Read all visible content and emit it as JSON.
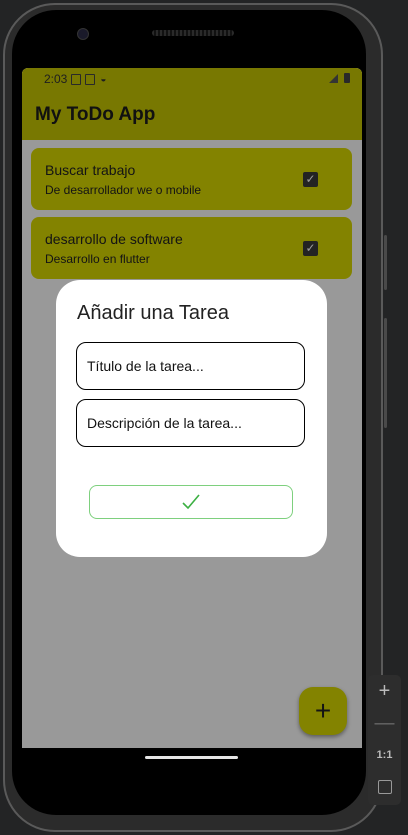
{
  "status_bar": {
    "time": "2:03"
  },
  "app_bar": {
    "title": "My ToDo App"
  },
  "tasks": [
    {
      "title": "Buscar trabajo",
      "description": "De desarrollador we o mobile",
      "checked": true
    },
    {
      "title": "desarrollo de software",
      "description": "Desarrollo en flutter",
      "checked": true
    }
  ],
  "dialog": {
    "title": "Añadir una Tarea",
    "title_placeholder": "Título de la tarea...",
    "description_placeholder": "Descripción de la tarea...",
    "confirm_icon": "check-icon"
  },
  "fab": {
    "icon": "plus-icon",
    "label": "+"
  },
  "emulator_controls": {
    "zoom_in": "+",
    "zoom_out": "—",
    "actual_size": "1:1"
  },
  "colors": {
    "accent": "#d6d600",
    "appbar": "#c4c402",
    "confirm_border": "#7ed07e",
    "check": "#3cb043"
  }
}
